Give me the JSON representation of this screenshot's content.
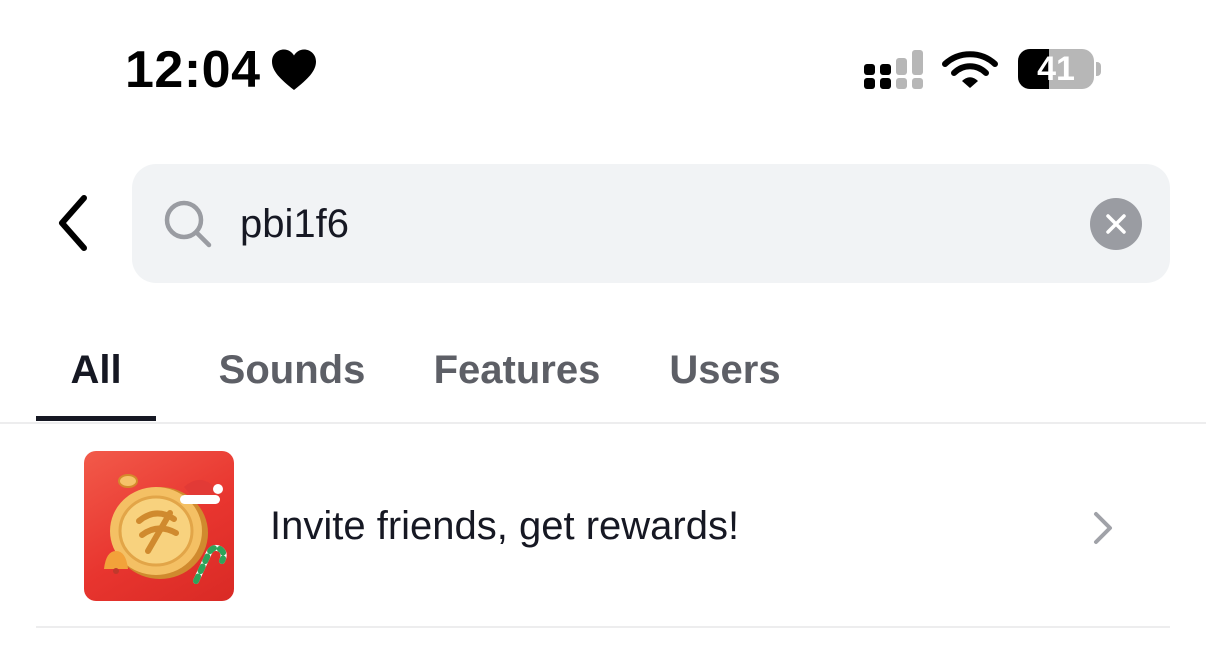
{
  "status_bar": {
    "time": "12:04",
    "battery_level": "41",
    "battery_fraction": 0.41
  },
  "search": {
    "value": "pbi1f6"
  },
  "tabs": [
    {
      "label": "All",
      "active": true
    },
    {
      "label": "Sounds",
      "active": false
    },
    {
      "label": "Features",
      "active": false
    },
    {
      "label": "Users",
      "active": false
    }
  ],
  "results": [
    {
      "label": "Invite friends, get rewards!",
      "icon": "gift-coin-icon"
    }
  ],
  "colors": {
    "text_primary": "#161823",
    "text_secondary": "#5d5f66",
    "search_bg": "#f1f3f5",
    "promo_red": "#e8352f"
  }
}
